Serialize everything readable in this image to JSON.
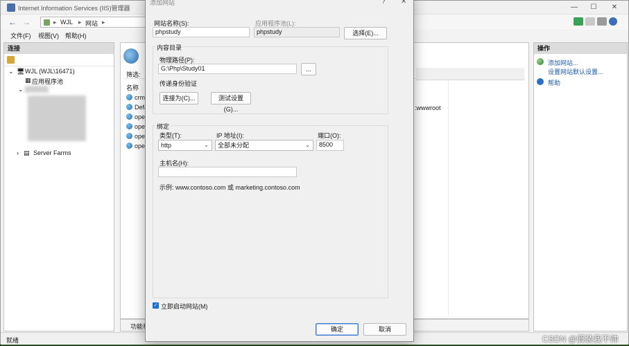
{
  "window": {
    "title": "Internet Information Services (IIS)管理器",
    "controls": [
      "—",
      "☐",
      "✕"
    ]
  },
  "address": {
    "crumbs": [
      "WJL",
      "网站"
    ]
  },
  "menu": [
    "文件(F)",
    "视图(V)",
    "帮助(H)"
  ],
  "connections": {
    "header": "连接",
    "root": "WJL (WJL\\16471)",
    "app_pools": "应用程序池",
    "server_farms": "Server Farms"
  },
  "center": {
    "filter_label": "筛选:",
    "name_header": "名称",
    "sites": [
      "crme",
      "Defa",
      "oper",
      "oper",
      "oper",
      "oper"
    ],
    "path_fragment": ":wwwroot",
    "bottom_tab": "功能视"
  },
  "actions": {
    "header": "操作",
    "add_site": "添加网站...",
    "set_defaults": "设置网站默认设置...",
    "help": "帮助"
  },
  "status": "就绪",
  "dialog": {
    "title": "添加网站",
    "help_glyph": "?",
    "close_glyph": "✕",
    "site_name_label": "网站名称(S):",
    "site_name_value": "phpstudy",
    "app_pool_label": "应用程序池(L):",
    "app_pool_value": "phpstudy",
    "select_button": "选择(E)...",
    "content_dir_group": "内容目录",
    "physical_path_label": "物理路径(P):",
    "physical_path_value": "G:\\Php\\Study01",
    "browse_button": "...",
    "passthrough_label": "传递身份验证",
    "connect_as_button": "连接为(C)...",
    "test_settings_button": "测试设置(G)...",
    "binding_group": "绑定",
    "type_label": "类型(T):",
    "type_value": "http",
    "ip_label": "IP 地址(I):",
    "ip_value": "全部未分配",
    "port_label": "端口(O):",
    "port_value": "8500",
    "host_label": "主机名(H):",
    "host_value": "",
    "example_text": "示例: www.contoso.com 或 marketing.contoso.com",
    "start_label": "立即启动网站(M)",
    "start_checked": true,
    "ok_button": "确定",
    "cancel_button": "取消"
  },
  "watermark": "CSDN @假装我不帅",
  "colors": {
    "link": "#1c5aa8",
    "check_accent": "#1d6fd6",
    "primary_border": "#3b7bd1"
  }
}
